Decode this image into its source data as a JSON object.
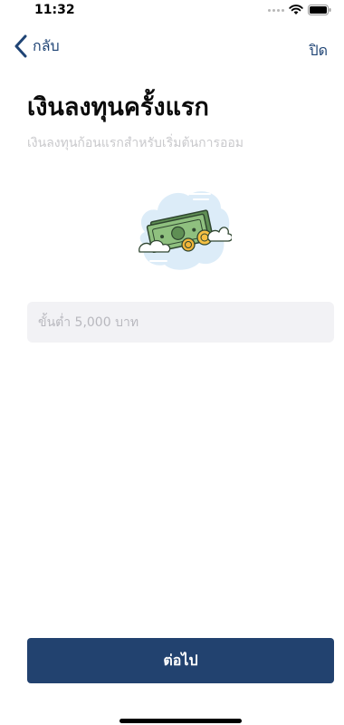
{
  "status_bar": {
    "time": "11:32"
  },
  "nav": {
    "back_label": "กลับ",
    "close_label": "ปิด"
  },
  "main": {
    "title": "เงินลงทุนครั้งแรก",
    "subtitle": "เงินลงทุนก้อนแรกสำหรับเริ่มต้นการออม",
    "illustration": "money-cloud-illustration",
    "amount_input": {
      "value": "",
      "placeholder": "ขั้นต่ำ 5,000 บาท"
    }
  },
  "footer": {
    "next_label": "ต่อไป"
  },
  "colors": {
    "brand": "#22426f",
    "link": "#1f4475",
    "input_bg": "#f2f2f5",
    "subtitle": "#c9c9cc"
  }
}
